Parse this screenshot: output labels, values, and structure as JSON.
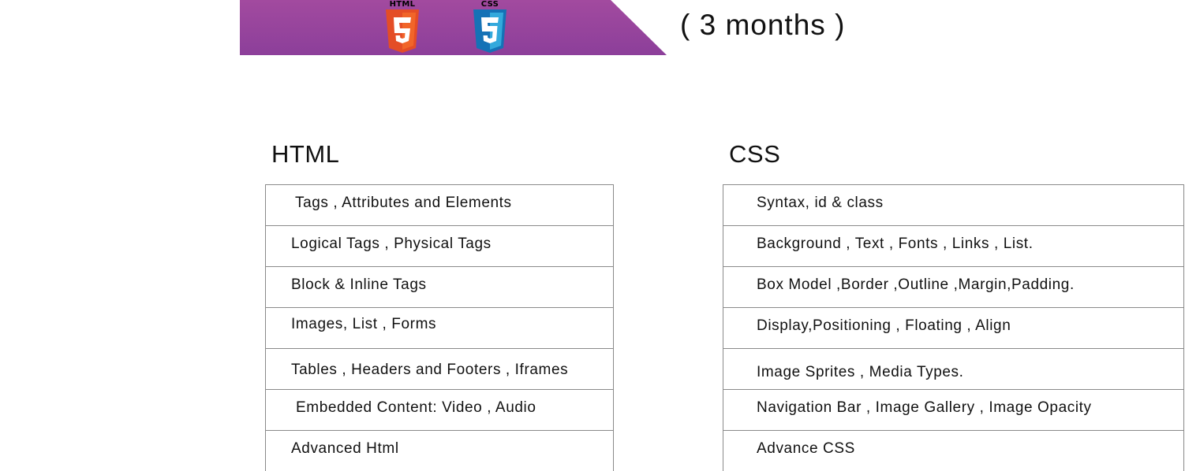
{
  "banner": {
    "gradient_top": "#a24a9f",
    "gradient_bottom": "#8c3f9a",
    "logos": [
      {
        "label": "HTML",
        "icon": "html5-icon",
        "color": "#e44d26",
        "shade": "#f16529",
        "digit": "5"
      },
      {
        "label": "CSS",
        "icon": "css3-icon",
        "color": "#1572b6",
        "shade": "#33a9dc",
        "digit": "3"
      }
    ]
  },
  "duration": "( 3 months )",
  "html_section": {
    "title": "HTML",
    "topics": [
      "Tags , Attributes and Elements",
      "Logical Tags , Physical Tags",
      "Block & Inline Tags",
      "Images, List , Forms",
      "Tables , Headers and Footers , Iframes",
      "Embedded Content: Video , Audio",
      "Advanced Html"
    ]
  },
  "css_section": {
    "title": "CSS",
    "topics": [
      "Syntax, id & class",
      "Background , Text , Fonts , Links , List.",
      "Box Model ,Border ,Outline ,Margin,Padding.",
      "Display,Positioning , Floating , Align",
      "Image Sprites , Media Types.",
      "Navigation Bar , Image Gallery , Image Opacity",
      "Advance CSS"
    ]
  }
}
